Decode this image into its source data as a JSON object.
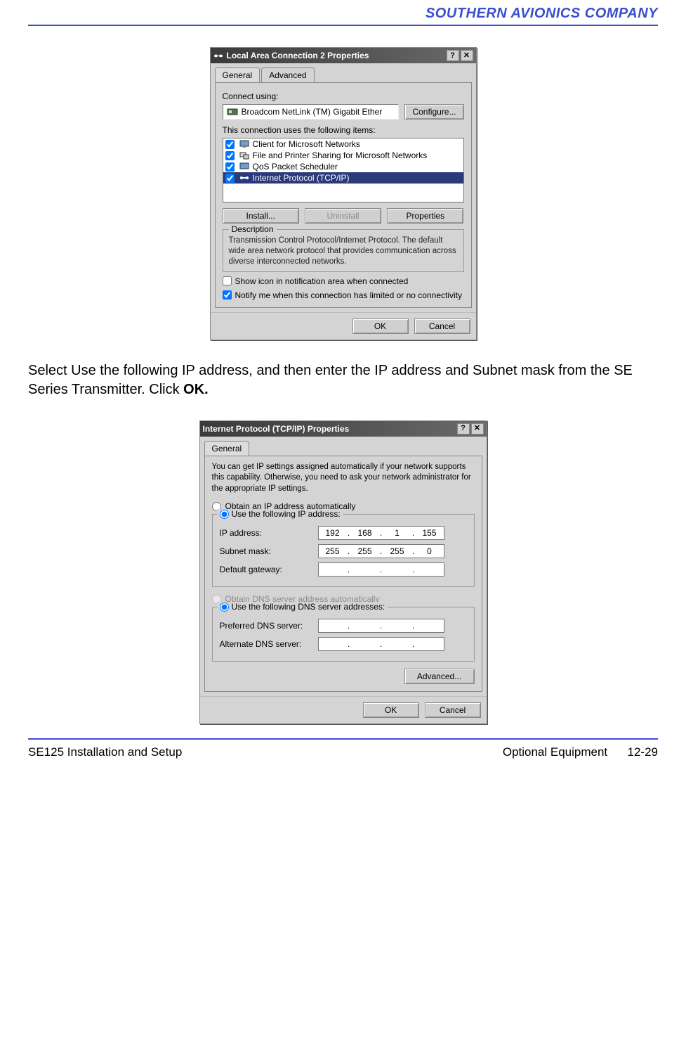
{
  "header": {
    "company": "SOUTHERN AVIONICS COMPANY"
  },
  "instruction": {
    "text_before_bold": "Select Use the following IP address, and then enter the IP address and Subnet mask from the SE Series Transmitter.  Click ",
    "bold": "OK."
  },
  "footer": {
    "left": "SE125 Installation and Setup",
    "center": "Optional Equipment",
    "right": "12-29"
  },
  "dlg1": {
    "title": "Local Area Connection 2 Properties",
    "help_glyph": "?",
    "close_glyph": "✕",
    "tabs": {
      "general": "General",
      "advanced": "Advanced"
    },
    "connect_using_label": "Connect using:",
    "adapter": "Broadcom NetLink (TM) Gigabit Ether",
    "configure_btn": "Configure...",
    "items_label": "This connection uses the following items:",
    "items": [
      {
        "label": "Client for Microsoft Networks",
        "checked": true,
        "selected": false
      },
      {
        "label": "File and Printer Sharing for Microsoft Networks",
        "checked": true,
        "selected": false
      },
      {
        "label": "QoS Packet Scheduler",
        "checked": true,
        "selected": false
      },
      {
        "label": "Internet Protocol (TCP/IP)",
        "checked": true,
        "selected": true
      }
    ],
    "install_btn": "Install...",
    "uninstall_btn": "Uninstall",
    "properties_btn": "Properties",
    "desc_legend": "Description",
    "desc_text": "Transmission Control Protocol/Internet Protocol. The default wide area network protocol that provides communication across diverse interconnected networks.",
    "show_icon_label": "Show icon in notification area when connected",
    "notify_label": "Notify me when this connection has limited or no connectivity",
    "show_icon_checked": false,
    "notify_checked": true,
    "ok_btn": "OK",
    "cancel_btn": "Cancel"
  },
  "dlg2": {
    "title": "Internet Protocol (TCP/IP) Properties",
    "help_glyph": "?",
    "close_glyph": "✕",
    "tab_general": "General",
    "info": "You can get IP settings assigned automatically if your network supports this capability. Otherwise, you need to ask your network administrator for the appropriate IP settings.",
    "obtain_ip": "Obtain an IP address automatically",
    "use_ip": "Use the following IP address:",
    "ip_label": "IP address:",
    "subnet_label": "Subnet mask:",
    "gateway_label": "Default gateway:",
    "ip": [
      "192",
      "168",
      "1",
      "155"
    ],
    "subnet": [
      "255",
      "255",
      "255",
      "0"
    ],
    "gateway": [
      "",
      "",
      "",
      ""
    ],
    "obtain_dns": "Obtain DNS server address automatically",
    "use_dns": "Use the following DNS server addresses:",
    "pref_dns_label": "Preferred DNS server:",
    "alt_dns_label": "Alternate DNS server:",
    "pref_dns": [
      "",
      "",
      "",
      ""
    ],
    "alt_dns": [
      "",
      "",
      "",
      ""
    ],
    "advanced_btn": "Advanced...",
    "ok_btn": "OK",
    "cancel_btn": "Cancel"
  }
}
